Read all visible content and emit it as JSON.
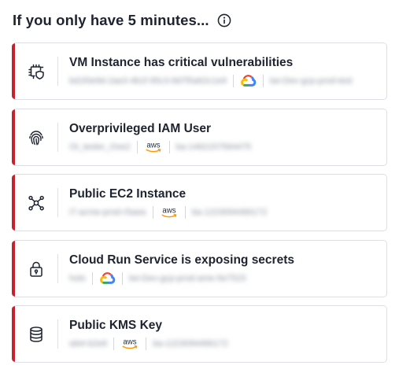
{
  "header": {
    "title": "If you only have 5 minutes...",
    "info_icon": "info-circle-icon"
  },
  "accent_color": "#c6222e",
  "findings": [
    {
      "title": "VM Instance has critical vulnerabilities",
      "icon": "chip-shield-icon",
      "provider": "gcp",
      "resource_id": "bd1f0e9d-2ae3-4b1f-95c3-8d7f0a62c1e9",
      "account": "lwi-Dev-gcp-prod-test"
    },
    {
      "title": "Overprivileged IAM User",
      "icon": "fingerprint-icon",
      "provider": "aws",
      "resource_id": "Ot_tester_Ove2",
      "account": "ba-1462157564475"
    },
    {
      "title": "Public EC2 Instance",
      "icon": "network-nodes-icon",
      "provider": "aws",
      "resource_id": "i7-acme-prod-r5aws",
      "account": "ba-1223094466172"
    },
    {
      "title": "Cloud Run Service is exposing secrets",
      "icon": "lock-icon",
      "provider": "gcp",
      "resource_id": "holo",
      "account": "lwi-Dev-gcp-prod-ame-5e7523"
    },
    {
      "title": "Public KMS Key",
      "icon": "database-icon",
      "provider": "aws",
      "resource_id": "wb4-b2e6",
      "account": "ba-1223094466172"
    }
  ]
}
